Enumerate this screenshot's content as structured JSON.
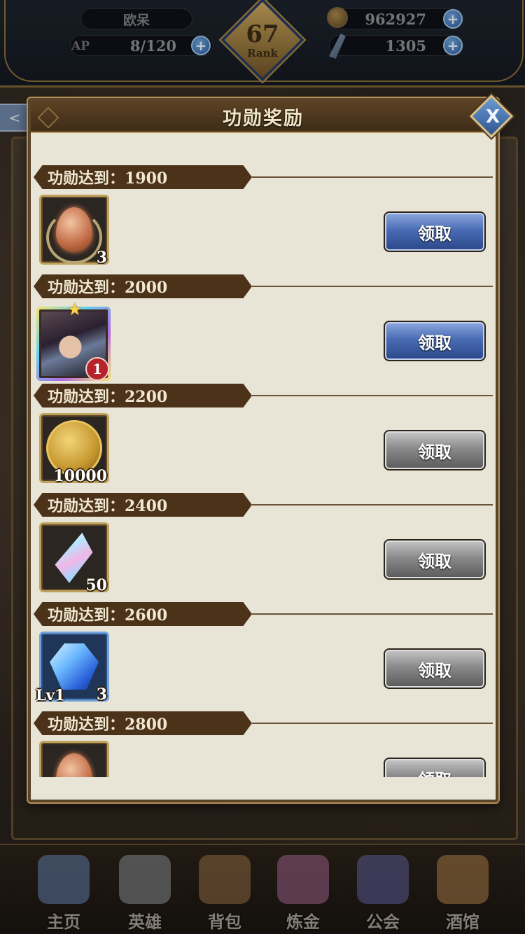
{
  "header": {
    "player_name": "欧呆",
    "ap_label": "AP",
    "ap_value": "8/120",
    "rank_number": "67",
    "rank_label": "Rank",
    "gold_value": "962927",
    "gem_value": "1305"
  },
  "modal": {
    "title": "功勋奖励",
    "close_label": "X",
    "rewards": [
      {
        "threshold_label": "功勋达到：1900",
        "item": "orange-orb",
        "quantity": "3",
        "level": "",
        "button_label": "领取",
        "button_state": "active"
      },
      {
        "threshold_label": "功勋达到：2000",
        "item": "hero-card",
        "quantity": "1",
        "level": "",
        "button_label": "领取",
        "button_state": "active"
      },
      {
        "threshold_label": "功勋达到：2200",
        "item": "gold-coin",
        "quantity": "10000",
        "level": "",
        "button_label": "领取",
        "button_state": "inactive"
      },
      {
        "threshold_label": "功勋达到：2400",
        "item": "rainbow-crystal",
        "quantity": "50",
        "level": "",
        "button_label": "领取",
        "button_state": "inactive"
      },
      {
        "threshold_label": "功勋达到：2600",
        "item": "blue-gem",
        "quantity": "3",
        "level": "Lv1",
        "button_label": "领取",
        "button_state": "inactive"
      },
      {
        "threshold_label": "功勋达到：2800",
        "item": "orange-orb",
        "quantity": "",
        "level": "",
        "button_label": "领取",
        "button_state": "inactive"
      }
    ]
  },
  "bottom_nav": [
    {
      "label": "主页",
      "icon": "castle-icon",
      "color": "#6d8fc4"
    },
    {
      "label": "英雄",
      "icon": "helmet-icon",
      "color": "#9aa0a8"
    },
    {
      "label": "背包",
      "icon": "bag-icon",
      "color": "#a67a4c"
    },
    {
      "label": "炼金",
      "icon": "flask-icon",
      "color": "#b0709a"
    },
    {
      "label": "公会",
      "icon": "shield-icon",
      "color": "#6a6ab0"
    },
    {
      "label": "酒馆",
      "icon": "barrel-icon",
      "color": "#c08d52"
    }
  ],
  "colors": {
    "modal_bg": "#e8e4d6",
    "ribbon": "#4b3219",
    "button_active": "#4a6cb4",
    "button_inactive": "#8a8a8a"
  }
}
